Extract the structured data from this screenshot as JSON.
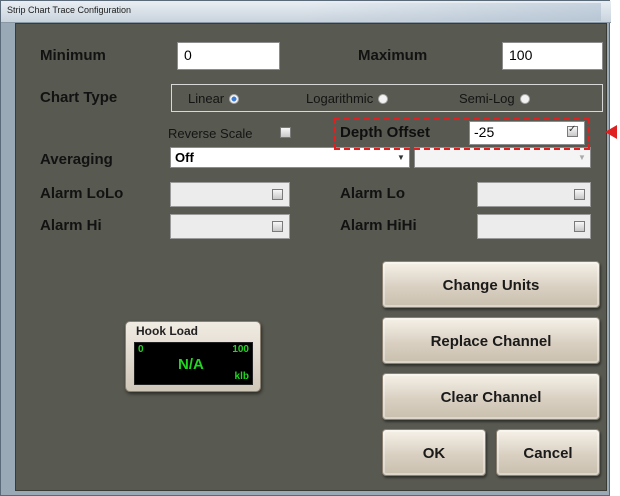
{
  "window": {
    "title": "Strip Chart Trace Configuration"
  },
  "range": {
    "minimum_label": "Minimum",
    "minimum_value": "0",
    "maximum_label": "Maximum",
    "maximum_value": "100"
  },
  "chart_type": {
    "label": "Chart Type",
    "options": [
      {
        "label": "Linear",
        "selected": true
      },
      {
        "label": "Logarithmic",
        "selected": false
      },
      {
        "label": "Semi-Log",
        "selected": false
      }
    ]
  },
  "reverse_scale": {
    "label": "Reverse Scale",
    "checked": false
  },
  "depth_offset": {
    "label": "Depth Offset",
    "value": "-25",
    "checked": true
  },
  "averaging": {
    "label": "Averaging",
    "value": "Off",
    "secondary_value": ""
  },
  "alarms": {
    "lolo_label": "Alarm LoLo",
    "lo_label": "Alarm Lo",
    "hi_label": "Alarm Hi",
    "hihi_label": "Alarm HiHi"
  },
  "buttons": {
    "change_units": "Change Units",
    "replace_channel": "Replace Channel",
    "clear_channel": "Clear Channel",
    "ok": "OK",
    "cancel": "Cancel"
  },
  "hook_load": {
    "title": "Hook Load",
    "min": "0",
    "max": "100",
    "value": "N/A",
    "unit": "klb"
  },
  "colors": {
    "panel": "#585950",
    "readout_green": "#20d620",
    "highlight_red": "#e02020"
  }
}
